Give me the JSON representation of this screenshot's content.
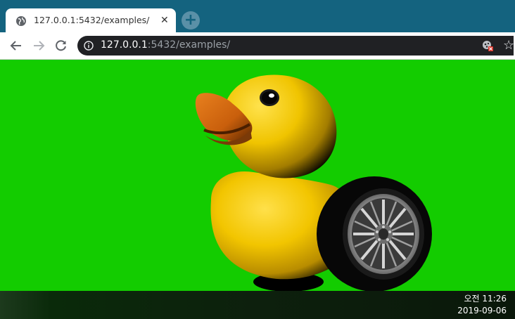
{
  "browser": {
    "tab": {
      "title": "127.0.0.1:5432/examples/",
      "favicon": "globe-icon",
      "close": "✕"
    },
    "new_tab": "+",
    "address": {
      "host": "127.0.0.1",
      "rest": ":5432/examples/"
    }
  },
  "scene": {
    "background_color": "#13cc00",
    "subject": "rubber-duck-with-wheel"
  },
  "taskbar": {
    "time": "오전 11:26",
    "date": "2019-09-06"
  }
}
